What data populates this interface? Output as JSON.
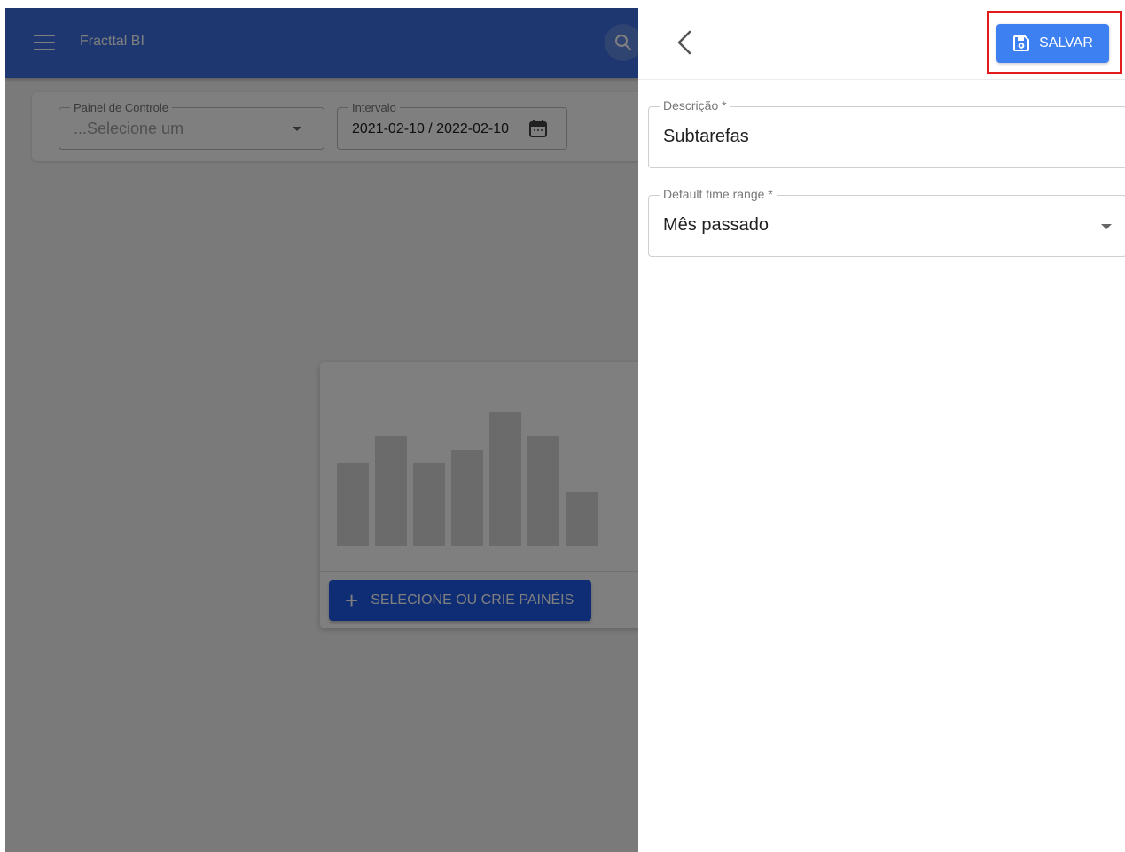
{
  "background_app": {
    "title": "Fracttal BI",
    "filters": {
      "dashboard_label": "Painel de Controle",
      "dashboard_placeholder": "...Selecione um",
      "interval_label": "Intervalo",
      "interval_value": "2021-02-10 / 2022-02-10"
    },
    "empty_state": {
      "bar_levels": [
        0.62,
        0.82,
        0.62,
        0.72,
        1.0,
        0.82,
        0.4
      ],
      "cta_label": "SELECIONE OU CRIE PAINÉIS"
    }
  },
  "panel": {
    "save_label": "SALVAR",
    "description_label": "Descrição *",
    "description_value": "Subtarefas",
    "time_range_label": "Default time range *",
    "time_range_value": "Mês passado"
  },
  "icons": [
    "menu-icon",
    "search-icon",
    "calendar-icon",
    "plus-icon",
    "back-arrow-icon",
    "save-icon",
    "chevron-down-icon"
  ],
  "colors": {
    "topbar": "#3d6ee0",
    "save_button": "#3d80f2",
    "cta_button": "#1f5ae8",
    "highlight": "#e21b1b"
  }
}
